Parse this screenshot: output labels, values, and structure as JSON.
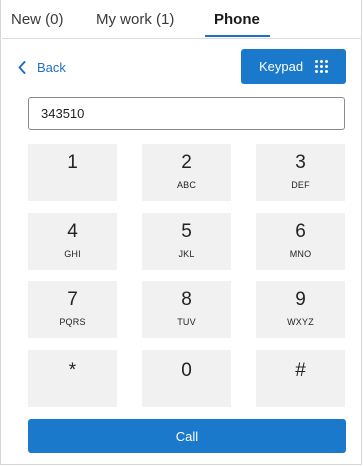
{
  "tabs": [
    {
      "label": "New (0)"
    },
    {
      "label": "My work (1)"
    },
    {
      "label": "Phone"
    }
  ],
  "active_tab": "Phone",
  "back": {
    "label": "Back",
    "icon": "chevron-left-icon"
  },
  "keypad_button": {
    "label": "Keypad",
    "icon": "dialpad-icon"
  },
  "phone_input": {
    "value": "343510"
  },
  "keys": [
    {
      "digit": "1",
      "letters": ""
    },
    {
      "digit": "2",
      "letters": "ABC"
    },
    {
      "digit": "3",
      "letters": "DEF"
    },
    {
      "digit": "4",
      "letters": "GHI"
    },
    {
      "digit": "5",
      "letters": "JKL"
    },
    {
      "digit": "6",
      "letters": "MNO"
    },
    {
      "digit": "7",
      "letters": "PQRS"
    },
    {
      "digit": "8",
      "letters": "TUV"
    },
    {
      "digit": "9",
      "letters": "WXYZ"
    },
    {
      "digit": "*",
      "letters": ""
    },
    {
      "digit": "0",
      "letters": ""
    },
    {
      "digit": "#",
      "letters": ""
    }
  ],
  "call_button": {
    "label": "Call"
  },
  "colors": {
    "accent": "#1b79cc",
    "link": "#1f6fc5",
    "key_background": "#f1f1f1"
  }
}
